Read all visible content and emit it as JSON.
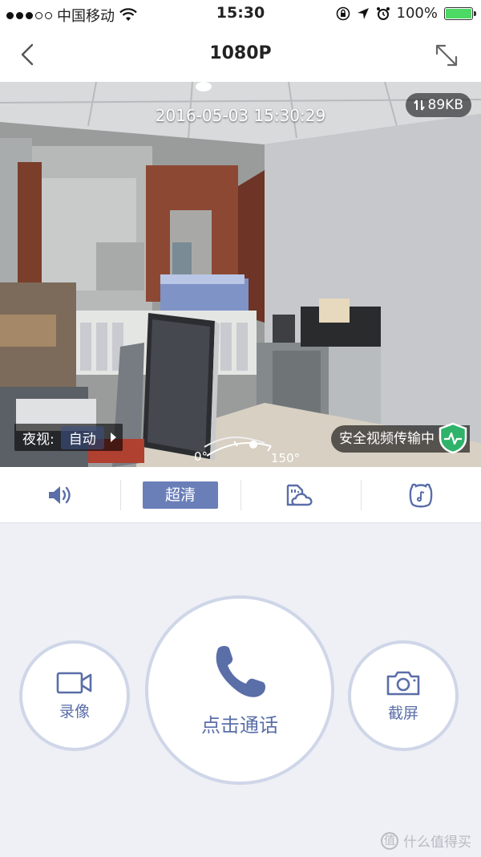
{
  "status_bar": {
    "carrier": "中国移动",
    "time": "15:30",
    "battery_text": "100%",
    "signal_dots_filled": 3,
    "signal_dots_total": 5
  },
  "nav": {
    "title": "1080P"
  },
  "video": {
    "timestamp": "2016-05-03 15:30:29",
    "data_rate": "89KB",
    "night_vision_label": "夜视:",
    "night_vision_value": "自动",
    "secure_text": "安全视频传输中",
    "pan_start": "0°",
    "pan_end": "150°"
  },
  "toolbar": {
    "quality_label": "超清",
    "icons": [
      "speaker-icon",
      "sd-cloud-icon",
      "sticker-icon"
    ]
  },
  "controls": {
    "record_label": "录像",
    "call_label": "点击通话",
    "screenshot_label": "截屏"
  },
  "watermark": {
    "logo_text": "值",
    "text": "什么值得买"
  },
  "colors": {
    "accent": "#6a7fb8",
    "circle_border": "#cfd6e8",
    "battery": "#4cd964",
    "secure_green": "#2fb36a"
  }
}
